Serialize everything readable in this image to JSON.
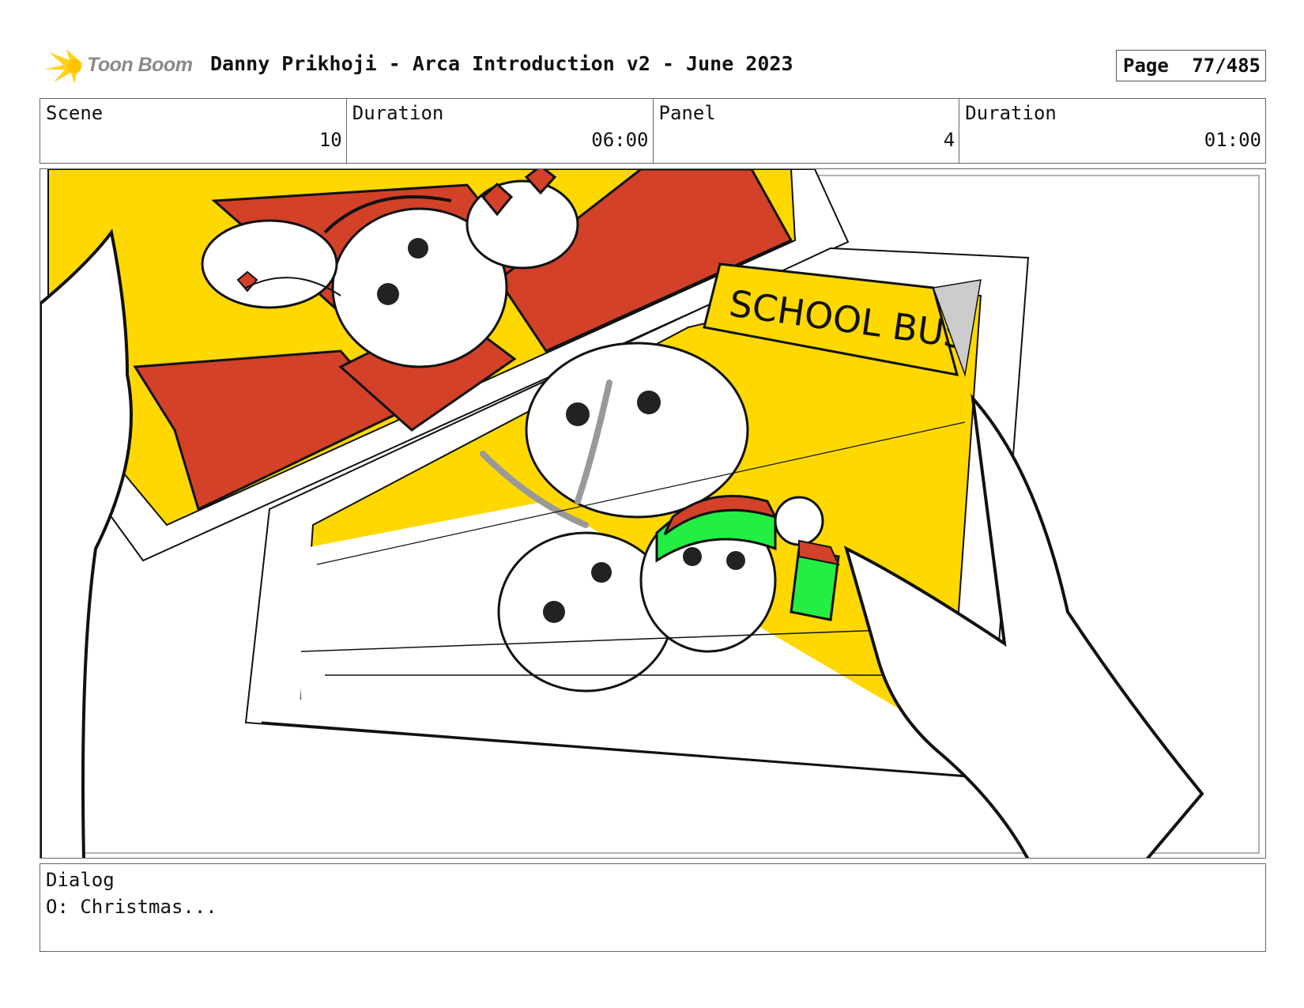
{
  "header": {
    "logo_text": "Toon Boom",
    "title": "Danny Prikhoji - Arca Introduction v2 - June 2023",
    "page_label": "Page",
    "page_number": "77/485"
  },
  "meta": {
    "scene_label": "Scene",
    "scene_value": "10",
    "scene_duration_label": "Duration",
    "scene_duration_value": "06:00",
    "panel_label": "Panel",
    "panel_value": "4",
    "panel_duration_label": "Duration",
    "panel_duration_value": "01:00"
  },
  "panel_image": {
    "sign_text": "SCHOOL BUS",
    "colors": {
      "yellow": "#FFD800",
      "red": "#D24128",
      "green": "#22EE44",
      "line": "#111111"
    }
  },
  "dialog": {
    "label": "Dialog",
    "text": "O: Christmas..."
  }
}
